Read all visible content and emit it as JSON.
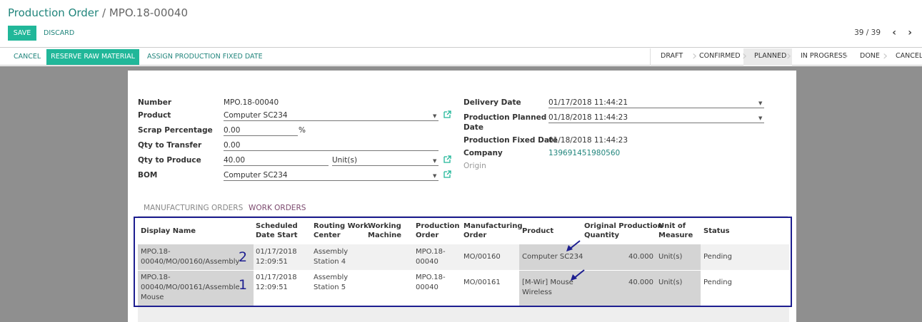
{
  "breadcrumb": {
    "root": "Production Order",
    "separator": "/",
    "current": "MPO.18-00040"
  },
  "buttons": {
    "save": "SAVE",
    "discard": "DISCARD"
  },
  "pager": {
    "value": "39 / 39",
    "prev": "‹",
    "next": "›"
  },
  "header_buttons": {
    "cancel": "CANCEL",
    "reserve": "RESERVE RAW MATERIAL",
    "assign": "ASSIGN PRODUCTION FIXED DATE"
  },
  "statusbar": [
    "DRAFT",
    "CONFIRMED",
    "PLANNED",
    "IN PROGRESS",
    "DONE",
    "CANCEL"
  ],
  "statusbar_active": "PLANNED",
  "form": {
    "number_label": "Number",
    "number": "MPO.18-00040",
    "product_label": "Product",
    "product": "Computer SC234",
    "scrap_label": "Scrap Percentage",
    "scrap": "0.00",
    "scrap_unit": "%",
    "qty_transfer_label": "Qty to Transfer",
    "qty_transfer": "0.00",
    "qty_produce_label": "Qty to Produce",
    "qty_produce": "40.00",
    "qty_uom": "Unit(s)",
    "bom_label": "BOM",
    "bom": "Computer SC234",
    "delivery_label": "Delivery Date",
    "delivery": "01/17/2018 11:44:21",
    "planned_label_1": "Production Planned",
    "planned_label_2": "Date",
    "planned": "01/18/2018 11:44:23",
    "fixed_label": "Production Fixed Date",
    "fixed": "01/18/2018 11:44:23",
    "company_label": "Company",
    "company": "139691451980560",
    "origin_label": "Origin"
  },
  "tabs": {
    "manufacturing": "MANUFACTURING ORDERS",
    "work": "WORK ORDERS"
  },
  "table": {
    "headers": [
      [
        "Display Name"
      ],
      [
        "Scheduled",
        "Date Start"
      ],
      [
        "Routing Work",
        "Center"
      ],
      [
        "Working",
        "Machine"
      ],
      [
        "Production",
        "Order"
      ],
      [
        "Manufacturing",
        "Order"
      ],
      [
        "Product"
      ],
      [
        "Original Production",
        "Quantity"
      ],
      [
        "Unit of",
        "Measure"
      ],
      [
        "Status"
      ]
    ],
    "rows": [
      {
        "display": [
          "MPO.18-",
          "00040/MO/00160/Assembly"
        ],
        "date": [
          "01/17/2018",
          "12:09:51"
        ],
        "center": [
          "Assembly",
          "Station 4"
        ],
        "machine": "",
        "po": [
          "MPO.18-",
          "00040"
        ],
        "mo": "MO/00160",
        "product": [
          "Computer SC234"
        ],
        "qty": "40.000",
        "uom": "Unit(s)",
        "status": "Pending",
        "marker": "2"
      },
      {
        "display": [
          "MPO.18-",
          "00040/MO/00161/Assemble",
          "Mouse"
        ],
        "date": [
          "01/17/2018",
          "12:09:51"
        ],
        "center": [
          "Assembly",
          "Station 5"
        ],
        "machine": "",
        "po": [
          "MPO.18-",
          "00040"
        ],
        "mo": "MO/00161",
        "product": [
          "[M-Wir] Mouse",
          "Wireless"
        ],
        "qty": "40.000",
        "uom": "Unit(s)",
        "status": "Pending",
        "marker": "1"
      }
    ]
  },
  "colors": {
    "primary": "#21b799",
    "link": "#21857c",
    "annotation": "#1d1e90",
    "active_tab": "#7c4a6f"
  }
}
